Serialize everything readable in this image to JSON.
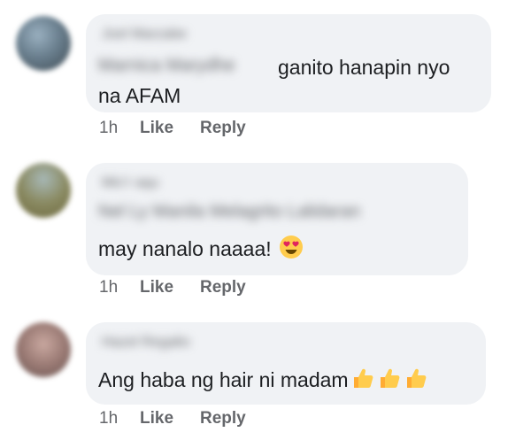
{
  "comments": [
    {
      "name": "Joel Marzabe",
      "mention": "Marnica Marydhe",
      "text_line1": "ganito hanapin nyo",
      "text_line2": "na AFAM",
      "time": "1h",
      "like_label": "Like",
      "reply_label": "Reply",
      "emoji": ""
    },
    {
      "name": "Mic'r aqu",
      "mention": "Nel Ly Manila Melagrito Lalidaran",
      "text_line1": "may nanalo naaaa!",
      "time": "1h",
      "like_label": "Like",
      "reply_label": "Reply",
      "emoji": "heart-eyes-emoji"
    },
    {
      "name": "Hazel Regalio",
      "text_line1": "Ang haba ng hair ni madam",
      "time": "1h",
      "like_label": "Like",
      "reply_label": "Reply",
      "emoji": "thumbs-up-emoji"
    }
  ],
  "colors": {
    "bubble": "#f0f2f5",
    "text": "#1c1e21",
    "meta": "#65676b"
  }
}
